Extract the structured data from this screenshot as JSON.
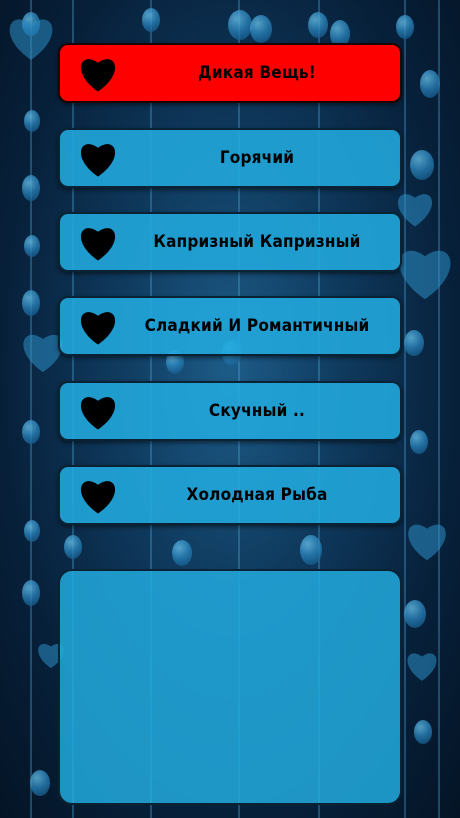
{
  "options": [
    {
      "label": "Дикая Вещь!",
      "selected": true
    },
    {
      "label": "Горячий",
      "selected": false
    },
    {
      "label": "Капризный Капризный",
      "selected": false
    },
    {
      "label": "Сладкий И Романтичный",
      "selected": false
    },
    {
      "label": "Скучный ..",
      "selected": false
    },
    {
      "label": "Холодная Рыба",
      "selected": false
    }
  ],
  "colors": {
    "selected": "#ff0000",
    "option": "#22aade",
    "background": "#0f3a5e",
    "heart": "#000000"
  },
  "icons": {
    "option_icon": "heart-icon"
  },
  "result_text": ""
}
